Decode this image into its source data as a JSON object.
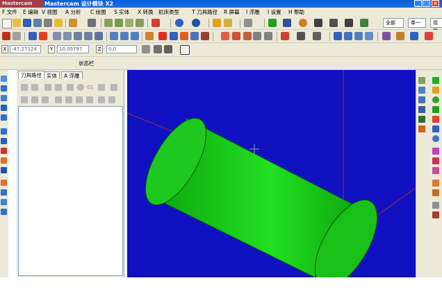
{
  "window": {
    "title": "Mastercam 设计模块  X2",
    "logo_text": "Mastercam",
    "minimize": "_",
    "maximize": "□",
    "close": "×"
  },
  "menubar": {
    "items": [
      "F 文件",
      "E 编辑",
      "V 视图",
      "A 分析",
      "C 绘图",
      "S 实体",
      "X 转换",
      "机床类型",
      "T 刀具路径",
      "R 屏幕",
      "I 浮雕",
      "I 设置",
      "H 帮助"
    ]
  },
  "toolbar": {
    "combo_all": "全部",
    "combo_single": "单一",
    "combo_view": "视图"
  },
  "coords": {
    "x_label": "X",
    "x_value": "-47.27124",
    "y_label": "Y",
    "y_value": "10.05797",
    "z_label": "Z",
    "z_value": "0.0"
  },
  "status_bar": {
    "label": "状态栏"
  },
  "operations_manager": {
    "tabs": [
      "刀具路径",
      "实体",
      "A 浮雕"
    ],
    "row1_text": "G1"
  },
  "colors": {
    "viewport_bg": "#1010c0",
    "cylinder": "#1ed81e",
    "axis": "#b03030"
  }
}
